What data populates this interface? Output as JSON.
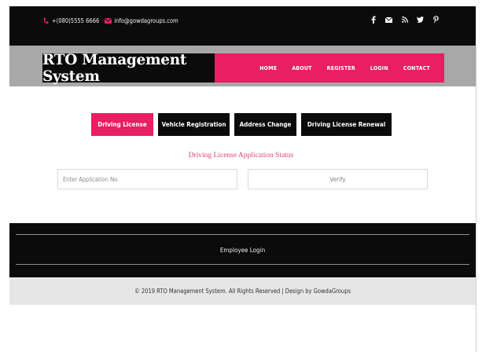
{
  "topbar": {
    "phone": "+(080)5555 6666",
    "email": "info@gowdagroups.com",
    "social_icons": [
      "facebook-icon",
      "envelope-icon",
      "rss-icon",
      "twitter-icon",
      "pinterest-icon"
    ]
  },
  "header": {
    "brand": "RTO Management System",
    "nav": [
      "HOME",
      "ABOUT",
      "REGISTER",
      "LOGIN",
      "CONTACT"
    ]
  },
  "tabs": [
    {
      "label": "Driving License",
      "active": true
    },
    {
      "label": "Vehicle Registration",
      "active": false
    },
    {
      "label": "Address Change",
      "active": false
    },
    {
      "label": "Driving License Renewal",
      "active": false
    }
  ],
  "status_form": {
    "title": "Driving License Application Status",
    "input_placeholder": "Enter Application No.",
    "button_label": "Verify"
  },
  "footer": {
    "employee_login": "Employee Login",
    "copyright": "© 2019 RTO Management System. All Rights Reserved | Design by GowdaGroups"
  },
  "colors": {
    "accent": "#e91e63",
    "dark": "#0b0b0b",
    "band_gray": "#a8a8a8",
    "footer_gray": "#e6e6e6"
  }
}
